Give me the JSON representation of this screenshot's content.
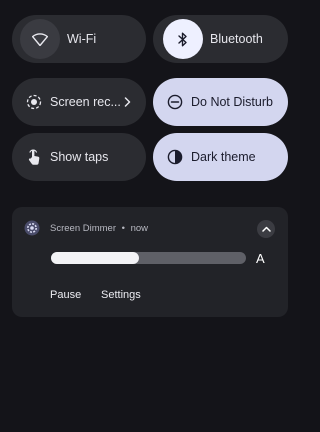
{
  "quick_settings": {
    "wifi": {
      "label": "Wi-Fi",
      "icon": "wifi-icon",
      "active": false
    },
    "bluetooth": {
      "label": "Bluetooth",
      "icon": "bluetooth-icon",
      "active": true
    },
    "screen_record": {
      "label": "Screen rec...",
      "icon": "screen-record-icon",
      "active": false
    },
    "do_not_disturb": {
      "label": "Do Not Disturb",
      "icon": "do-not-disturb-icon",
      "active": true
    },
    "show_taps": {
      "label": "Show taps",
      "icon": "touch-icon",
      "active": false
    },
    "dark_theme": {
      "label": "Dark theme",
      "icon": "dark-theme-icon",
      "active": true
    }
  },
  "notification": {
    "app_icon": "gear-icon",
    "app_name": "Screen Dimmer",
    "separator": "•",
    "time": "now",
    "slider_level": 0.45,
    "auto_label": "A",
    "actions": {
      "pause": "Pause",
      "settings": "Settings"
    }
  },
  "colors": {
    "background": "#141419",
    "tile_off": "#2b2c31",
    "tile_on": "#d3d6ef",
    "card": "#222328"
  }
}
